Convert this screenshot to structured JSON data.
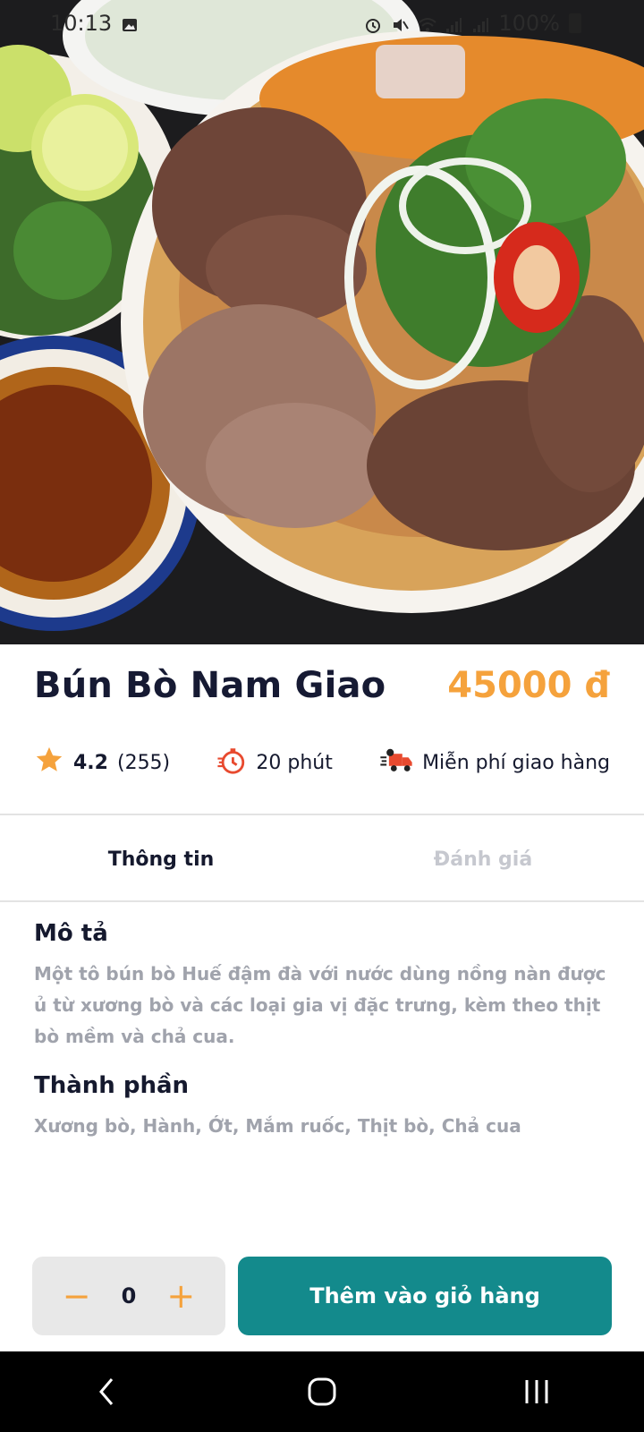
{
  "status_bar": {
    "time": "10:13",
    "battery": "100%",
    "icons": [
      "image-icon",
      "alarm-icon",
      "mute-icon",
      "wifi-icon",
      "signal-icon",
      "signal-icon",
      "battery-icon"
    ]
  },
  "hero": {
    "image_name": "bun-bo-hue-photo"
  },
  "dish": {
    "name": "Bún Bò Nam Giao",
    "price": "45000 đ"
  },
  "meta": {
    "rating": "4.2",
    "reviews": "(255)",
    "time": "20 phút",
    "delivery": "Miễn phí giao hàng",
    "icons": {
      "rating": "star-icon",
      "time": "stopwatch-icon",
      "delivery": "delivery-truck-icon"
    }
  },
  "tabs": [
    {
      "label": "Thông tin",
      "active": true
    },
    {
      "label": "Đánh giá",
      "active": false
    }
  ],
  "description": {
    "title": "Mô tả",
    "text": "Một tô bún bò Huế đậm đà với nước dùng nồng nàn được ủ từ xương bò và các loại gia vị đặc trưng, kèm theo thịt bò mềm và chả cua."
  },
  "ingredients": {
    "title": "Thành phần",
    "text": "Xương bò, Hành, Ớt, Mắm ruốc, Thịt bò, Chả cua"
  },
  "cart": {
    "quantity": "0",
    "minus": "−",
    "plus": "+",
    "add_label": "Thêm vào giỏ hàng"
  },
  "colors": {
    "accent": "#f5a23c",
    "primary": "#138a8c",
    "text": "#15192e",
    "muted": "#a0a3ac"
  }
}
